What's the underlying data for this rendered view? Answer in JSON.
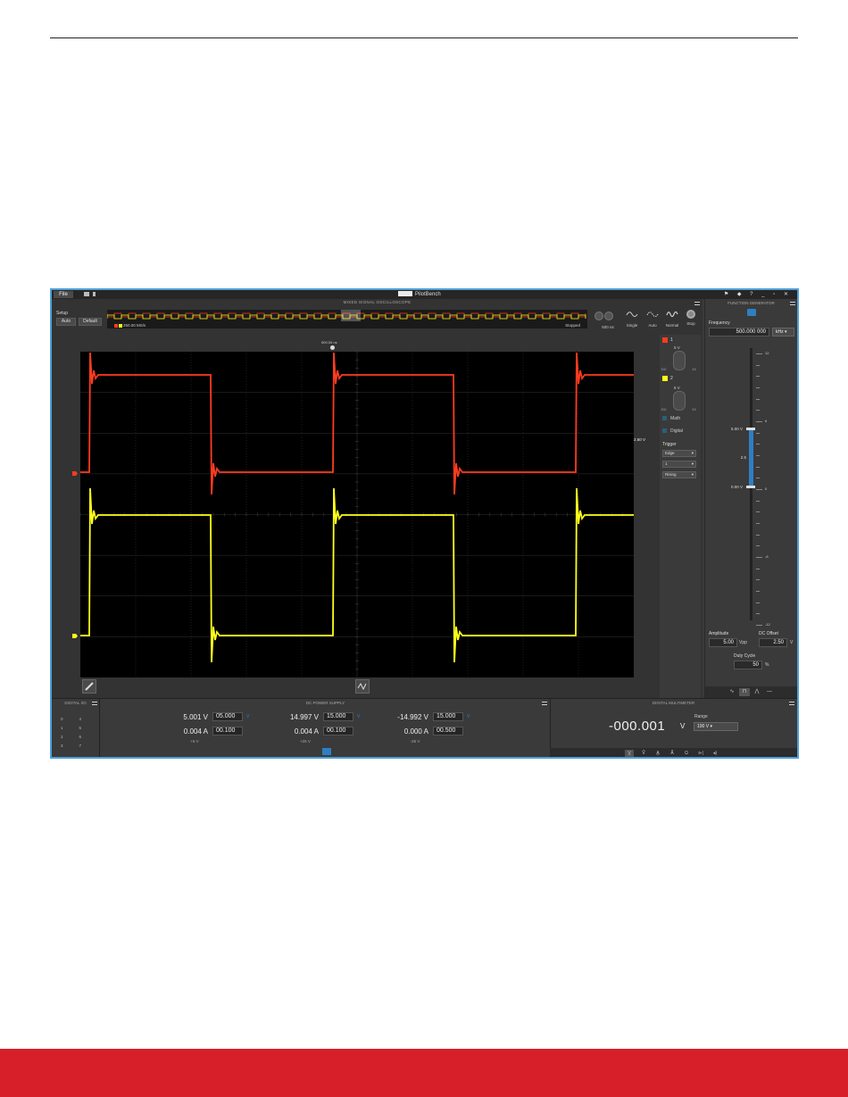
{
  "window": {
    "file_label": "File",
    "brand": "PilotBench"
  },
  "scope": {
    "title": "MIXED SIGNAL OSCILLOSCOPE",
    "setup_label": "Setup",
    "auto_label": "Auto",
    "default_label": "Default",
    "sample_rate": "250.00 MS/s",
    "state": "Stopped",
    "timebase": "500 ns",
    "modes": [
      "Single",
      "Auto",
      "Normal",
      "Stop"
    ],
    "trigger_time": "500.00 ns",
    "trigger_level_readout": "2.50 V",
    "channel_colors": {
      "ch1": "#ff3b1f",
      "ch2": "#ffff1a"
    },
    "channels": [
      {
        "num": "1",
        "scale": "5 V",
        "coupling_left": "DC",
        "coupling_right": "1X"
      },
      {
        "num": "2",
        "scale": "5 V",
        "coupling_left": "DC",
        "coupling_right": "1X"
      }
    ],
    "math_label": "Math",
    "digital_label": "Digital",
    "trigger": {
      "label": "Trigger",
      "type": "Edge",
      "source": "1",
      "slope": "Rising"
    }
  },
  "function_generator": {
    "title": "FUNCTION GENERATOR",
    "frequency_label": "Frequency",
    "frequency_value": "500.000 000",
    "frequency_unit": "kHz",
    "slider_upper": "5.00 V",
    "slider_lower": "0.00 V",
    "slider_mid": "2.5",
    "ticks": [
      "12",
      "6",
      "0",
      "-6",
      "-12"
    ],
    "amplitude_label": "Amplitude",
    "amplitude_value": "5.00",
    "amplitude_unit": "Vpp",
    "offset_label": "DC Offset",
    "offset_value": "2.50",
    "offset_unit": "V",
    "duty_label": "Duty Cycle",
    "duty_value": "50",
    "duty_unit": "%"
  },
  "digital_io": {
    "title": "DIGITAL I/O",
    "rows": [
      {
        "a": "0",
        "b": "4"
      },
      {
        "a": "1",
        "b": "5"
      },
      {
        "a": "2",
        "b": "6"
      },
      {
        "a": "3",
        "b": "7"
      }
    ]
  },
  "power_supply": {
    "title": "DC POWER SUPPLY",
    "channels": [
      {
        "measured_v": "5.001 V",
        "set_v": "05.000",
        "measured_a": "0.004 A",
        "set_a": "00.100",
        "label": "+6 V"
      },
      {
        "measured_v": "14.997 V",
        "set_v": "15.000",
        "measured_a": "0.004 A",
        "set_a": "00.100",
        "label": "+25 V"
      },
      {
        "measured_v": "-14.992 V",
        "set_v": "15.000",
        "measured_a": "0.000 A",
        "set_a": "00.500",
        "label": "-25 V"
      }
    ],
    "unit_v": "V"
  },
  "dmm": {
    "title": "DIGITAL MULTIMETER",
    "value": "-000.001",
    "unit": "V",
    "range_label": "Range",
    "range_value": "100 V"
  }
}
